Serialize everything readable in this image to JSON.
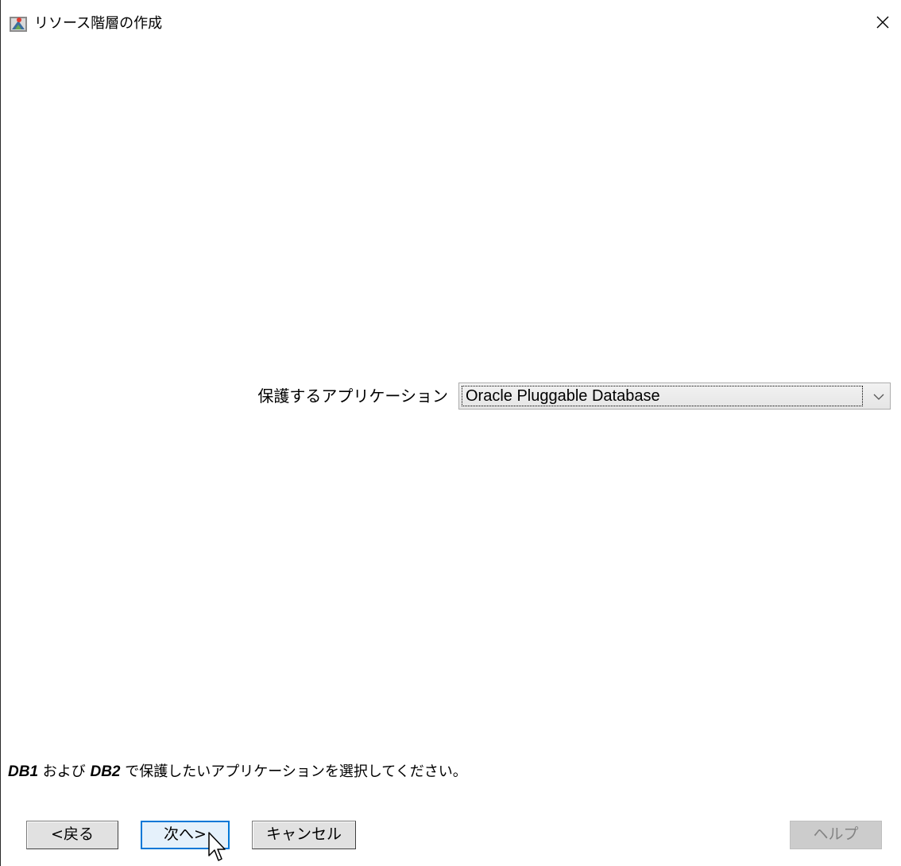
{
  "window": {
    "title": "リソース階層の作成",
    "app_icon": "oracle-wizard-icon",
    "close_icon": "close-icon"
  },
  "form": {
    "application_label": "保護するアプリケーション",
    "application_value": "Oracle Pluggable Database",
    "dropdown_icon": "chevron-down-icon"
  },
  "instruction": {
    "db1": "DB1",
    "and_text": " および ",
    "db2": "DB2",
    "rest_text": " で保護したいアプリケーションを選択してください。"
  },
  "buttons": {
    "back": "<戻る",
    "next": "次へ>",
    "cancel": "キャンセル",
    "help": "ヘルプ"
  },
  "colors": {
    "focus_border": "#0078d7",
    "button_face": "#e1e1e1",
    "disabled_text": "#838383"
  },
  "cursor_icon": "mouse-pointer-icon"
}
